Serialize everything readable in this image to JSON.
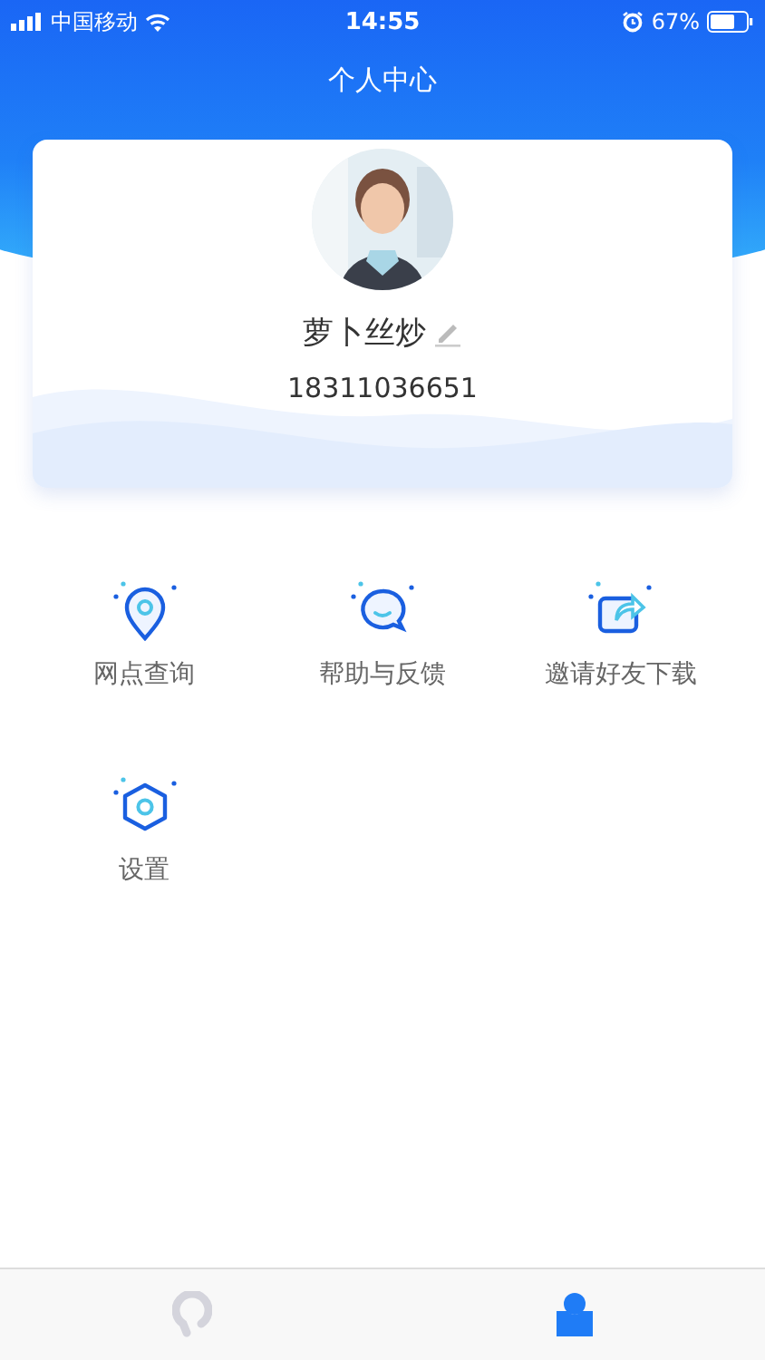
{
  "status_bar": {
    "carrier": "中国移动",
    "time": "14:55",
    "battery": "67%"
  },
  "header": {
    "title": "个人中心"
  },
  "profile": {
    "kind": "picture",
    "name": "萝卜丝炒",
    "phone": "18311036651"
  },
  "menu": [
    {
      "kind": "pin",
      "label": "网点查询"
    },
    {
      "kind": "chat",
      "label": "帮助与反馈"
    },
    {
      "kind": "share",
      "label": "邀请好友下载"
    },
    {
      "kind": "settings",
      "label": "设置"
    }
  ],
  "tabs": [
    {
      "kind": "home",
      "selected": false
    },
    {
      "kind": "profile",
      "selected": true
    }
  ]
}
